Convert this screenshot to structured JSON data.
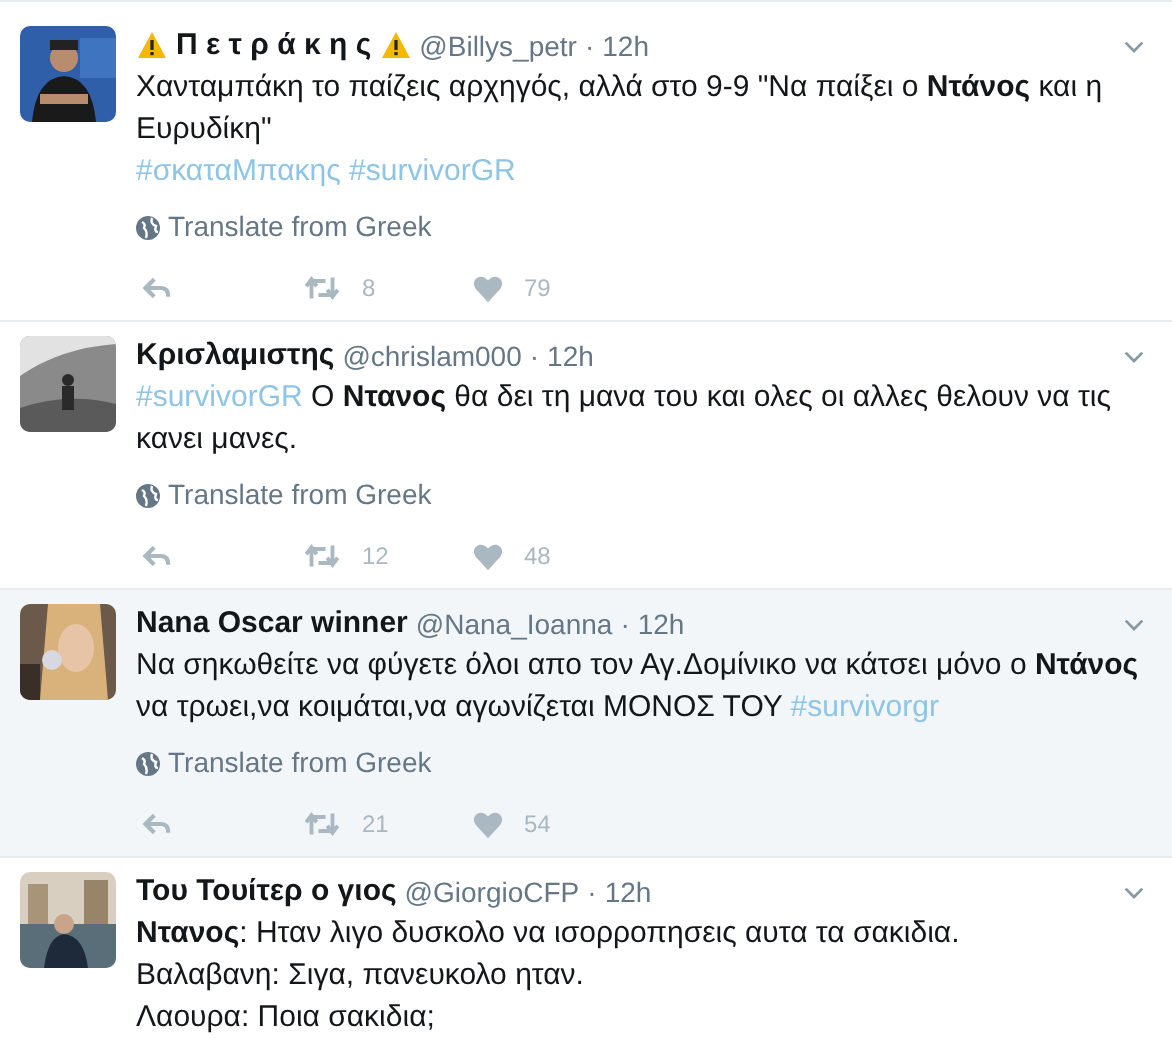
{
  "tweets": [
    {
      "selected": false,
      "avatar": {
        "kind": "picture"
      },
      "warning_badges": true,
      "name": "Π ε τ ρ ά κ η ς",
      "handle": "@Billys_petr",
      "separator": "·",
      "time": "12h",
      "paragraphs": [
        [
          {
            "kind": "text",
            "text": "Χανταμπάκη το παίζεις αρχηγός, αλλά στο 9-9 \"Να παίξει ο **Ντάνος** και η Ευρυδίκη\""
          }
        ],
        [
          {
            "kind": "hashtag",
            "text": "#σκαταΜπακης"
          },
          {
            "kind": "hashtag",
            "text": "#survivorGR"
          }
        ]
      ],
      "translate": "Translate from Greek",
      "retweets": "8",
      "likes": "79"
    },
    {
      "selected": false,
      "avatar": {
        "kind": "picture"
      },
      "name": "Κρισλαμιστης",
      "handle": "@chrislam000",
      "separator": "·",
      "time": "12h",
      "paragraphs": [
        [
          {
            "kind": "hashtag",
            "text": "#survivorGR"
          },
          {
            "kind": "text",
            "text": "Ο **Ντανος** θα δει τη μανα του και ολες οι αλλες θελουν να τις κανει μανες."
          }
        ]
      ],
      "translate": "Translate from Greek",
      "retweets": "12",
      "likes": "48"
    },
    {
      "selected": true,
      "avatar": {
        "kind": "picture"
      },
      "name": "Nana Oscar winner",
      "handle": "@Nana_Ioanna",
      "separator": "·",
      "time": "12h",
      "paragraphs": [
        [
          {
            "kind": "text",
            "text": "Να σηκωθείτε να φύγετε όλοι απο τον Αγ.Δομίνικο να κάτσει μόνο ο **Ντάνος** να τρωει,να κοιμάται,να αγωνίζεται ΜΟΝΟΣ ΤΟΥ"
          },
          {
            "kind": "hashtag",
            "text": "#survivorgr"
          }
        ]
      ],
      "translate": "Translate from Greek",
      "retweets": "21",
      "likes": "54"
    },
    {
      "selected": false,
      "avatar": {
        "kind": "picture"
      },
      "name": "Του Τουίτερ ο γιος",
      "handle": "@GiorgioCFP",
      "separator": "·",
      "time": "12h",
      "paragraphs": [
        [
          {
            "kind": "text",
            "text": "**Ντανος**: Ηταν λιγο δυσκολο να ισορροπησεις αυτα τα σακιδια."
          }
        ],
        [
          {
            "kind": "text",
            "text": "Βαλαβανη: Σιγα, πανευκολο ηταν."
          }
        ],
        [
          {
            "kind": "text",
            "text": "Λαουρα: Ποια σακιδια;"
          }
        ]
      ]
    }
  ]
}
